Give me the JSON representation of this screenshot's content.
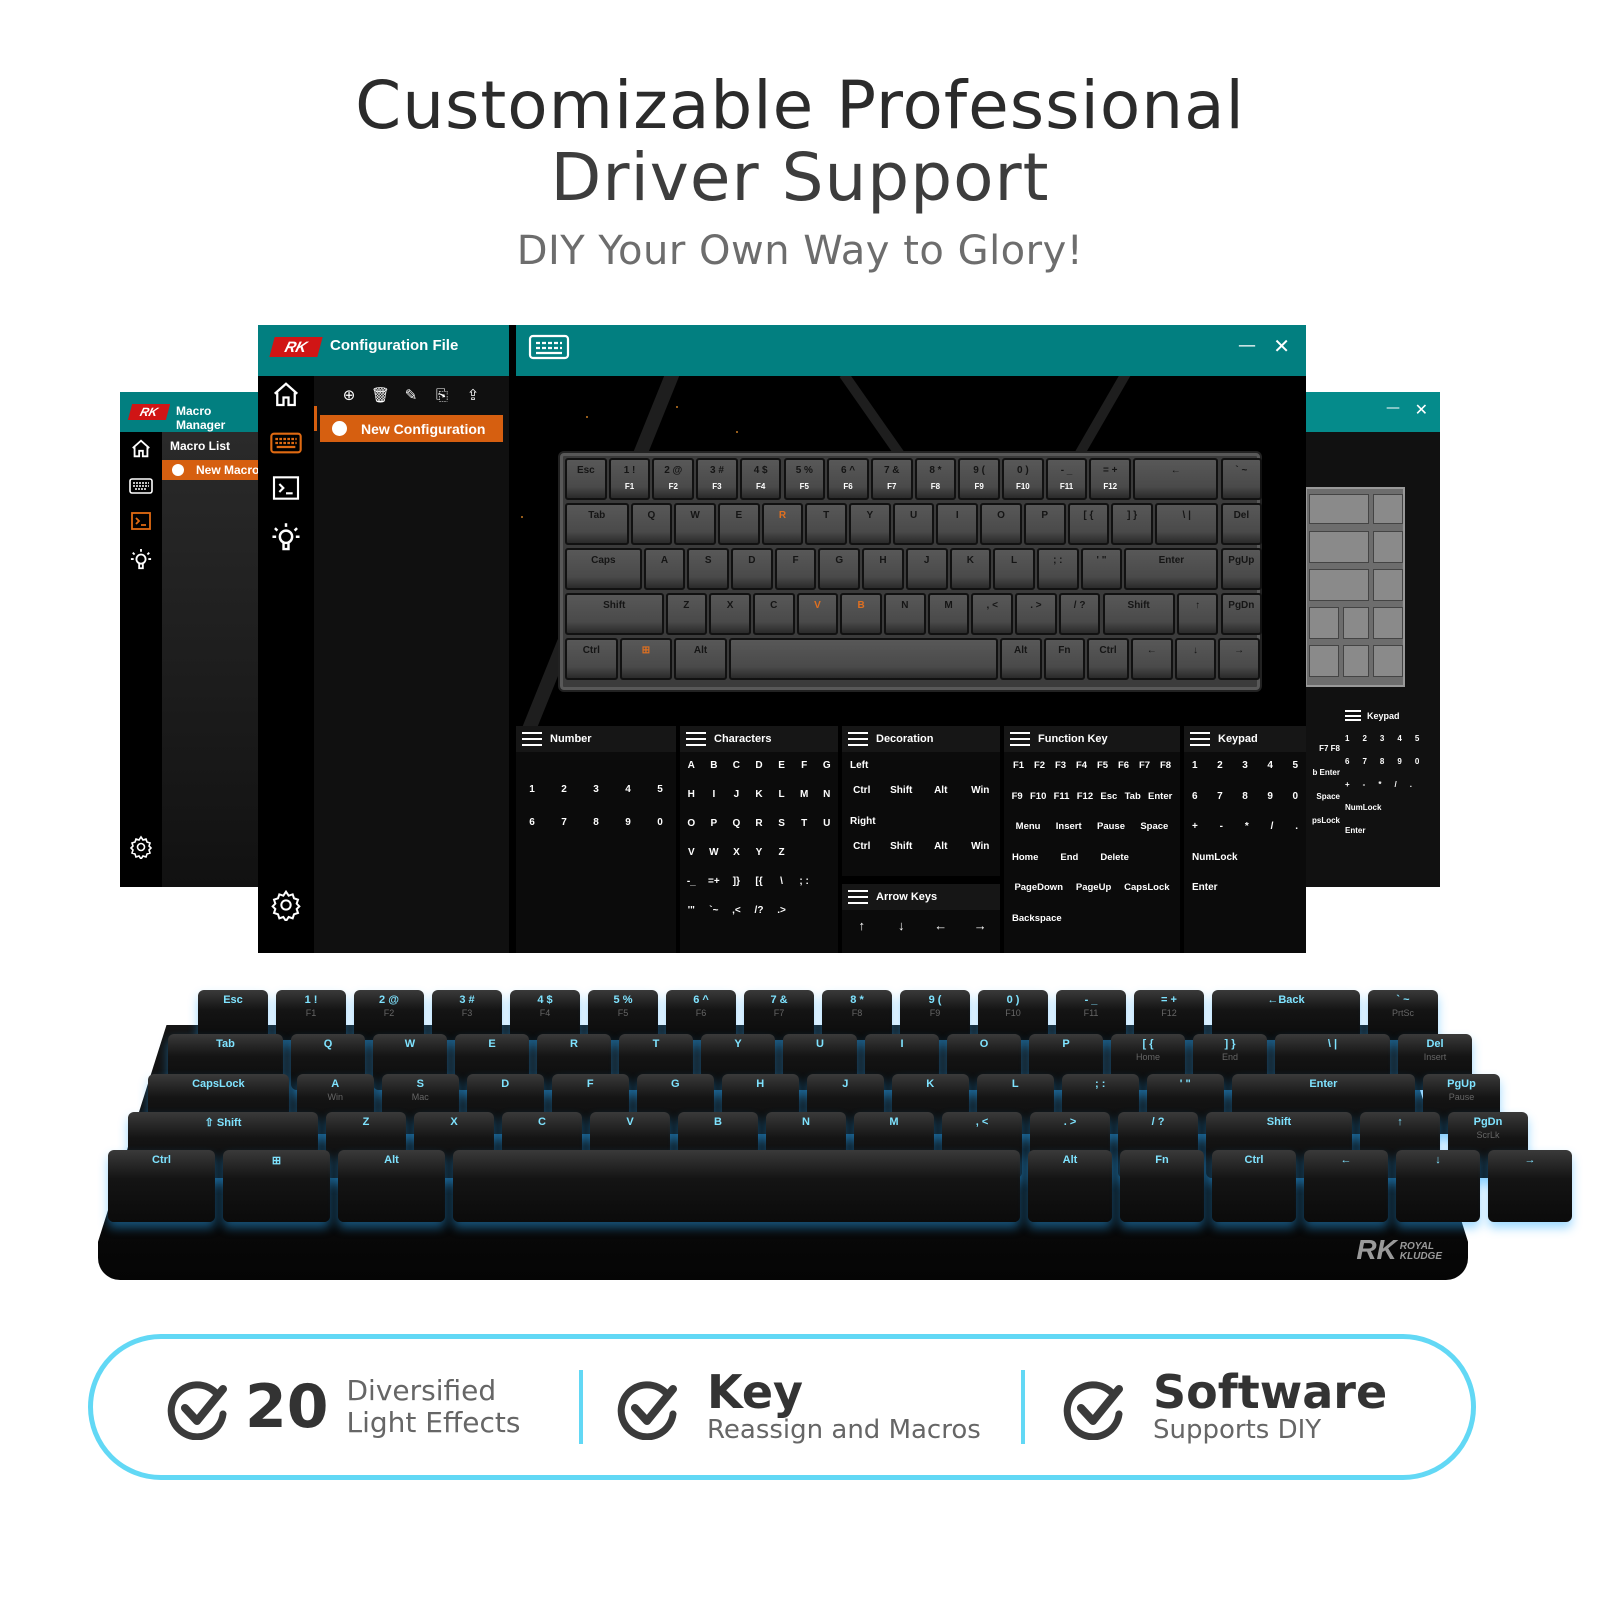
{
  "hero": {
    "title_line1": "Customizable Professional",
    "title_line2": "Driver Support",
    "subtitle": "DIY Your Own Way to Glory!"
  },
  "macro_window": {
    "logo": "RK",
    "title": "Macro Manager",
    "list_header": "Macro List",
    "selected_item": "New Macro",
    "icons": [
      "home-icon",
      "keyboard-icon",
      "terminal-icon",
      "bulb-icon",
      "gear-icon"
    ],
    "active_icon": "terminal-icon"
  },
  "config_window": {
    "logo": "RK",
    "title": "Configuration File",
    "toolbar": [
      "add-icon",
      "delete-icon",
      "edit-icon",
      "import-icon",
      "export-icon"
    ],
    "selected_item": "New Configuration",
    "rail_icons": [
      "home-icon",
      "keyboard-icon",
      "terminal-icon",
      "bulb-icon",
      "gear-icon"
    ],
    "active_icon": "keyboard-icon",
    "window_controls": {
      "minimize": "—",
      "close": "✕"
    },
    "keyboard": {
      "rows": [
        [
          {
            "k": "Esc"
          },
          {
            "k": "1 !",
            "s": "F1"
          },
          {
            "k": "2 @",
            "s": "F2"
          },
          {
            "k": "3 #",
            "s": "F3"
          },
          {
            "k": "4 $",
            "s": "F4"
          },
          {
            "k": "5 %",
            "s": "F5"
          },
          {
            "k": "6 ^",
            "s": "F6"
          },
          {
            "k": "7 &",
            "s": "F7"
          },
          {
            "k": "8 *",
            "s": "F8"
          },
          {
            "k": "9 (",
            "s": "F9"
          },
          {
            "k": "0 )",
            "s": "F10"
          },
          {
            "k": "- _",
            "s": "F11"
          },
          {
            "k": "= +",
            "s": "F12"
          },
          {
            "k": "←"
          },
          {
            "k": "` ~"
          }
        ],
        [
          {
            "k": "Tab"
          },
          {
            "k": "Q"
          },
          {
            "k": "W"
          },
          {
            "k": "E"
          },
          {
            "k": "R",
            "o": true
          },
          {
            "k": "T"
          },
          {
            "k": "Y"
          },
          {
            "k": "U"
          },
          {
            "k": "I"
          },
          {
            "k": "O"
          },
          {
            "k": "P"
          },
          {
            "k": "[ {"
          },
          {
            "k": "] }"
          },
          {
            "k": "\\ |"
          },
          {
            "k": "Del"
          }
        ],
        [
          {
            "k": "Caps"
          },
          {
            "k": "A"
          },
          {
            "k": "S"
          },
          {
            "k": "D"
          },
          {
            "k": "F"
          },
          {
            "k": "G"
          },
          {
            "k": "H"
          },
          {
            "k": "J"
          },
          {
            "k": "K"
          },
          {
            "k": "L"
          },
          {
            "k": "; :"
          },
          {
            "k": "' \""
          },
          {
            "k": "Enter"
          },
          {
            "k": "PgUp"
          }
        ],
        [
          {
            "k": "Shift"
          },
          {
            "k": "Z"
          },
          {
            "k": "X"
          },
          {
            "k": "C"
          },
          {
            "k": "V",
            "o": true
          },
          {
            "k": "B",
            "o": true
          },
          {
            "k": "N"
          },
          {
            "k": "M"
          },
          {
            "k": ", <"
          },
          {
            "k": ". >"
          },
          {
            "k": "/ ?"
          },
          {
            "k": "Shift"
          },
          {
            "k": "↑"
          },
          {
            "k": "PgDn"
          }
        ],
        [
          {
            "k": "Ctrl"
          },
          {
            "k": "⊞",
            "o": true
          },
          {
            "k": "Alt"
          },
          {
            "k": ""
          },
          {
            "k": "Alt"
          },
          {
            "k": "Fn"
          },
          {
            "k": "Ctrl"
          },
          {
            "k": "←"
          },
          {
            "k": "↓"
          },
          {
            "k": "→"
          }
        ]
      ]
    },
    "categories": {
      "number": {
        "title": "Number",
        "keys": [
          "1",
          "2",
          "3",
          "4",
          "5",
          "6",
          "7",
          "8",
          "9",
          "0"
        ]
      },
      "characters": {
        "title": "Characters",
        "keys": [
          "A",
          "B",
          "C",
          "D",
          "E",
          "F",
          "G",
          "H",
          "I",
          "J",
          "K",
          "L",
          "M",
          "N",
          "O",
          "P",
          "Q",
          "R",
          "S",
          "T",
          "U",
          "V",
          "W",
          "X",
          "Y",
          "Z",
          "",
          "",
          "-_",
          "=+",
          "]}",
          "[{",
          "\\",
          "; :",
          "",
          "'\"",
          "`~",
          ",<",
          "/?",
          ".>",
          "",
          ""
        ]
      },
      "decoration": {
        "title": "Decoration",
        "left_label": "Left",
        "right_label": "Right",
        "keys": [
          "Ctrl",
          "Shift",
          "Alt",
          "Win"
        ]
      },
      "arrow_keys": {
        "title": "Arrow Keys",
        "keys": [
          "↑",
          "↓",
          "←",
          "→"
        ]
      },
      "function_key": {
        "title": "Function Key",
        "row1": [
          "F1",
          "F2",
          "F3",
          "F4",
          "F5",
          "F6",
          "F7",
          "F8"
        ],
        "row2": [
          "F9",
          "F10",
          "F11",
          "F12",
          "Esc",
          "Tab",
          "Enter"
        ],
        "row3": [
          "Menu",
          "Insert",
          "Pause",
          "Space"
        ],
        "row4": [
          "Home",
          "End",
          "Delete"
        ],
        "row5": [
          "PageDown",
          "PageUp",
          "CapsLock"
        ],
        "row6": [
          "Backspace"
        ]
      },
      "keypad": {
        "title": "Keypad",
        "row1": [
          "1",
          "2",
          "3",
          "4",
          "5"
        ],
        "row2": [
          "6",
          "7",
          "8",
          "9",
          "0"
        ],
        "row3": [
          "+",
          "-",
          "*",
          "/",
          "."
        ],
        "row4": [
          "NumLock"
        ],
        "row5": [
          "Enter"
        ]
      }
    }
  },
  "keypad_window": {
    "title": "Keypad",
    "window_controls": {
      "minimize": "—",
      "close": "✕"
    },
    "partial_labels": [
      "F7  F8",
      "b  Enter",
      "Space",
      "psLock"
    ],
    "row1": [
      "1",
      "2",
      "3",
      "4",
      "5"
    ],
    "row2": [
      "6",
      "7",
      "8",
      "9",
      "0"
    ],
    "row3": [
      "+",
      "-",
      "*",
      "/",
      "."
    ],
    "row4": "NumLock",
    "row5": "Enter"
  },
  "physical_keyboard": {
    "brand": "RK",
    "brand_sub1": "ROYAL",
    "brand_sub2": "KLUDGE",
    "backlight_color": "#7fe3ff",
    "rows": [
      [
        {
          "k": "Esc"
        },
        {
          "k": "1 !",
          "s": "F1"
        },
        {
          "k": "2 @",
          "s": "F2"
        },
        {
          "k": "3 #",
          "s": "F3"
        },
        {
          "k": "4 $",
          "s": "F4"
        },
        {
          "k": "5 %",
          "s": "F5"
        },
        {
          "k": "6 ^",
          "s": "F6"
        },
        {
          "k": "7 &",
          "s": "F7"
        },
        {
          "k": "8 *",
          "s": "F8"
        },
        {
          "k": "9 (",
          "s": "F9"
        },
        {
          "k": "0 )",
          "s": "F10"
        },
        {
          "k": "- _",
          "s": "F11"
        },
        {
          "k": "= +",
          "s": "F12"
        },
        {
          "k": "←Back"
        },
        {
          "k": "` ~",
          "s": "PrtSc"
        }
      ],
      [
        {
          "k": "Tab"
        },
        {
          "k": "Q"
        },
        {
          "k": "W"
        },
        {
          "k": "E"
        },
        {
          "k": "R"
        },
        {
          "k": "T"
        },
        {
          "k": "Y"
        },
        {
          "k": "U"
        },
        {
          "k": "I"
        },
        {
          "k": "O"
        },
        {
          "k": "P"
        },
        {
          "k": "[ {",
          "s": "Home"
        },
        {
          "k": "] }",
          "s": "End"
        },
        {
          "k": "\\ |"
        },
        {
          "k": "Del",
          "s": "Insert"
        }
      ],
      [
        {
          "k": "CapsLock"
        },
        {
          "k": "A",
          "s": "Win"
        },
        {
          "k": "S",
          "s": "Mac"
        },
        {
          "k": "D"
        },
        {
          "k": "F"
        },
        {
          "k": "G"
        },
        {
          "k": "H"
        },
        {
          "k": "J"
        },
        {
          "k": "K"
        },
        {
          "k": "L"
        },
        {
          "k": "; :"
        },
        {
          "k": "' \""
        },
        {
          "k": "Enter"
        },
        {
          "k": "PgUp",
          "s": "Pause"
        }
      ],
      [
        {
          "k": "⇧ Shift"
        },
        {
          "k": "Z"
        },
        {
          "k": "X"
        },
        {
          "k": "C"
        },
        {
          "k": "V"
        },
        {
          "k": "B"
        },
        {
          "k": "N"
        },
        {
          "k": "M"
        },
        {
          "k": ", <"
        },
        {
          "k": ". >"
        },
        {
          "k": "/ ?"
        },
        {
          "k": "Shift"
        },
        {
          "k": "↑"
        },
        {
          "k": "PgDn",
          "s": "ScrLk"
        }
      ],
      [
        {
          "k": "Ctrl"
        },
        {
          "k": "⊞"
        },
        {
          "k": "Alt"
        },
        {
          "k": ""
        },
        {
          "k": "Alt"
        },
        {
          "k": "Fn"
        },
        {
          "k": "Ctrl"
        },
        {
          "k": "←"
        },
        {
          "k": "↓"
        },
        {
          "k": "→"
        }
      ]
    ]
  },
  "features": [
    {
      "number": "20",
      "line1": "Diversified",
      "line2": "Light Effects"
    },
    {
      "title": "Key",
      "subtitle": "Reassign and Macros"
    },
    {
      "title": "Software",
      "subtitle": "Supports DIY"
    }
  ],
  "colors": {
    "accent_teal": "#027f80",
    "accent_orange": "#d65f10",
    "pill_border": "#62d8f5"
  }
}
